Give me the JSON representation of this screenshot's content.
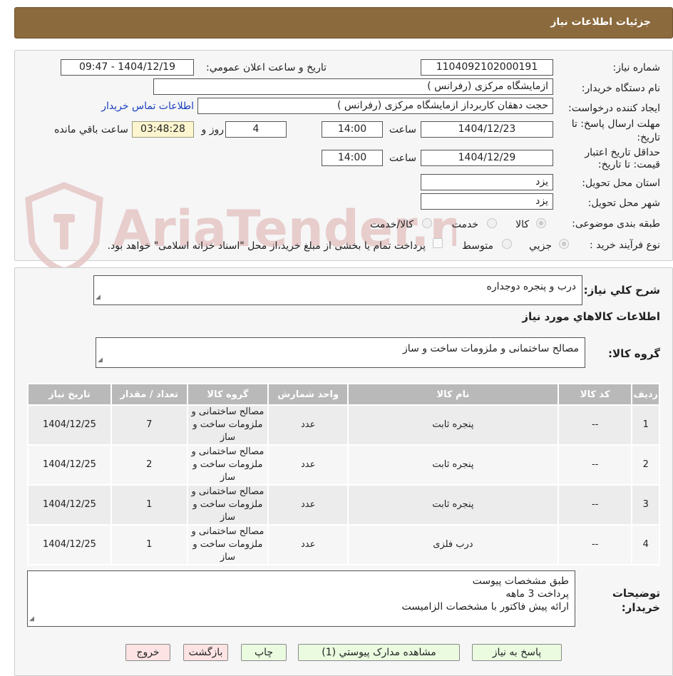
{
  "window": {
    "title": "جزئیات اطلاعات نیاز"
  },
  "watermark": {
    "text": "AriaTender.net",
    "color": "#e7c9c9"
  },
  "colors": {
    "header": "#8b6a3d",
    "table_header": "#b9b9b9",
    "button_green": "#eafbe0",
    "button_red": "#fde3e3",
    "link": "#1a3fbf"
  },
  "form": {
    "need_number_label": "شماره نیاز:",
    "need_number": "1104092102000191",
    "announce_label": "تاریخ و ساعت اعلان عمومي:",
    "announce_value": "1404/12/19 - 09:47",
    "buyer_org_label": "نام دستگاه خريدار:",
    "buyer_org": "ازمایشگاه مرکزی (رفرانس )",
    "requester_label": "ايجاد کننده درخواست:",
    "requester": "حجت دهقان کاربرداز ازمایشگاه مرکزی (رفرانس )",
    "contact_link": "اطلاعات تماس خريدار",
    "reply_deadline_label": "مهلت ارسال پاسخ: تا تاریخ:",
    "reply_date": "1404/12/23",
    "time_label": "ساعت",
    "reply_time": "14:00",
    "days": "4",
    "days_label": "روز و",
    "remaining_time": "03:48:28",
    "remaining_label": "ساعت باقي مانده",
    "price_validity_label": "حداقل تاريخ اعتبار قيمت: تا تاريخ:",
    "validity_date": "1404/12/29",
    "validity_time": "14:00",
    "province_label": "استان محل تحويل:",
    "province": "یزد",
    "city_label": "شهر محل تحويل:",
    "city": "یزد",
    "category_label": "طبقه بندی موضوعی:",
    "category_options": [
      "کالا",
      "خدمت",
      "کالا/خدمت"
    ],
    "process_label": "نوع فرآيند خريد :",
    "process_options": [
      "جزیي",
      "متوسط"
    ],
    "payment_note": "پرداخت تمام یا بخشی از مبلغ خرید،از محل \"اسناد خزانه اسلامی\" خواهد بود."
  },
  "details": {
    "summary_label": "شرح کلي نياز:",
    "summary": "درب و پنجره دوجداره",
    "goods_section_title": "اطلاعات کالاهاي مورد نياز",
    "goods_group_label": "گروه کالا:",
    "goods_group": "مصالح ساختمانی و ملزومات ساخت و ساز"
  },
  "table": {
    "headers": [
      "رديف",
      "کد کالا",
      "نام کالا",
      "واحد شمارش",
      "گروه کالا",
      "تعداد / مقدار",
      "تاريخ نياز"
    ],
    "rows": [
      {
        "idx": "1",
        "code": "--",
        "name": "پنجره ثابت",
        "unit": "عدد",
        "group": "مصالح ساختمانی و ملزومات ساخت و ساز",
        "qty": "7",
        "date": "1404/12/25"
      },
      {
        "idx": "2",
        "code": "--",
        "name": "پنجره ثابت",
        "unit": "عدد",
        "group": "مصالح ساختمانی و ملزومات ساخت و ساز",
        "qty": "2",
        "date": "1404/12/25"
      },
      {
        "idx": "3",
        "code": "--",
        "name": "پنجره ثابت",
        "unit": "عدد",
        "group": "مصالح ساختمانی و ملزومات ساخت و ساز",
        "qty": "1",
        "date": "1404/12/25"
      },
      {
        "idx": "4",
        "code": "--",
        "name": "درب فلزی",
        "unit": "عدد",
        "group": "مصالح ساختمانی و ملزومات ساخت و ساز",
        "qty": "1",
        "date": "1404/12/25"
      }
    ]
  },
  "buyer_notes": {
    "label_line1": "توضيحات",
    "label_line2": "خريدار:",
    "lines": [
      "طبق مشخصات پیوست",
      "پرداخت 3 ماهه",
      "ارائه پیش فاکتور با مشخصات الزامیست"
    ]
  },
  "buttons": {
    "reply": "پاسخ به نياز",
    "attachments": "مشاهده مدارک پيوستي (1)",
    "print": "چاپ",
    "back": "بازگشت",
    "exit": "خروج"
  }
}
